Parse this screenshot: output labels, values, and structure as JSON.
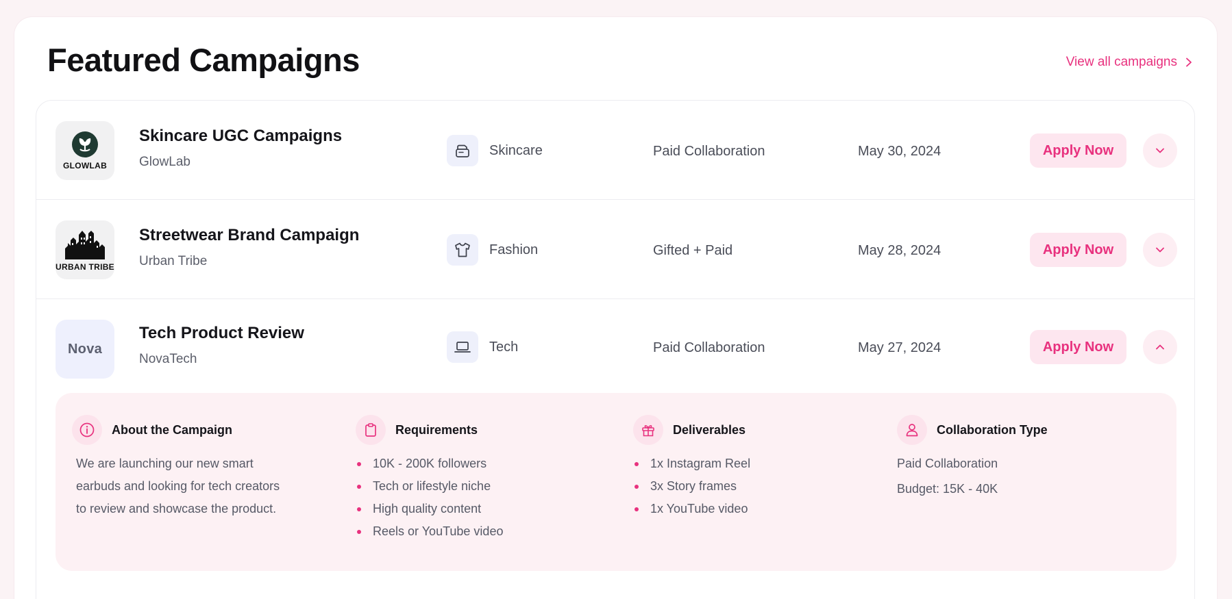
{
  "header": {
    "title": "Featured Campaigns",
    "view_all": "View all campaigns"
  },
  "accent_color": "#e8317e",
  "campaigns": [
    {
      "logo_text": "GLOWLAB",
      "title": "Skincare UGC Campaigns",
      "brand": "GlowLab",
      "category": "Skincare",
      "category_icon": "cream-jar-icon",
      "collaboration": "Paid Collaboration",
      "date": "May 30, 2024",
      "apply_label": "Apply Now",
      "expanded": false
    },
    {
      "logo_text": "URBAN TRIBE",
      "title": "Streetwear Brand Campaign",
      "brand": "Urban Tribe",
      "category": "Fashion",
      "category_icon": "tshirt-icon",
      "collaboration": "Gifted + Paid",
      "date": "May 28, 2024",
      "apply_label": "Apply Now",
      "expanded": false
    },
    {
      "logo_text": "Nova",
      "title": "Tech Product Review",
      "brand": "NovaTech",
      "category": "Tech",
      "category_icon": "laptop-icon",
      "collaboration": "Paid Collaboration",
      "date": "May 27, 2024",
      "apply_label": "Apply Now",
      "expanded": true
    }
  ],
  "details": {
    "about": {
      "title": "About the Campaign",
      "icon": "info-icon",
      "lines": [
        "We are launching our new smart",
        "earbuds and looking for tech creators",
        "to review and showcase the product."
      ]
    },
    "requirements": {
      "title": "Requirements",
      "icon": "clipboard-icon",
      "items": [
        "10K - 200K followers",
        "Tech or lifestyle niche",
        "High quality content",
        "Reels or YouTube video"
      ]
    },
    "deliverables": {
      "title": "Deliverables",
      "icon": "gift-icon",
      "items": [
        "1x Instagram Reel",
        "3x Story frames",
        "1x YouTube video"
      ]
    },
    "collaboration_type": {
      "title": "Collaboration Type",
      "icon": "user-icon",
      "type": "Paid Collaboration",
      "budget": "Budget: 15K - 40K"
    }
  }
}
